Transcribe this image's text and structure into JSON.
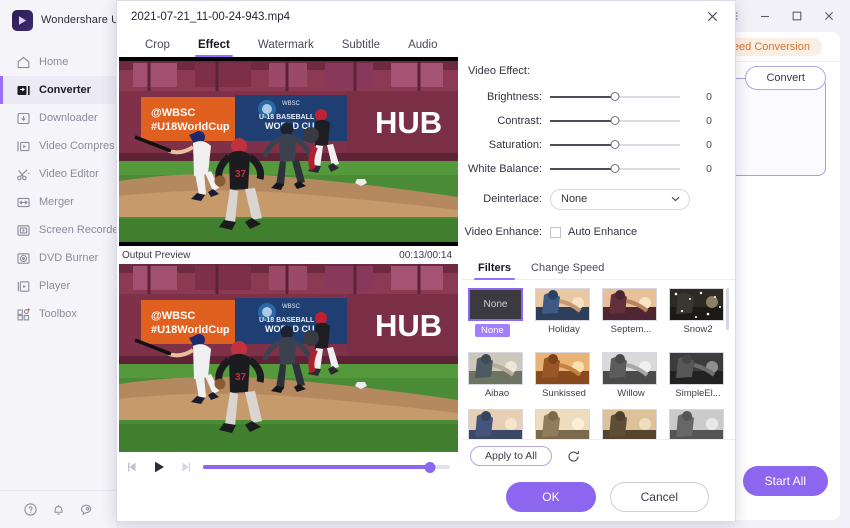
{
  "sidebar": {
    "brand": "Wondershare U",
    "items": [
      {
        "label": "Home",
        "icon": "home-icon",
        "active": false
      },
      {
        "label": "Converter",
        "icon": "converter-icon",
        "active": true
      },
      {
        "label": "Downloader",
        "icon": "download-icon",
        "active": false
      },
      {
        "label": "Video Compres",
        "icon": "compress-icon",
        "active": false
      },
      {
        "label": "Video Editor",
        "icon": "scissors-icon",
        "active": false
      },
      {
        "label": "Merger",
        "icon": "merge-icon",
        "active": false
      },
      {
        "label": "Screen Recorde",
        "icon": "record-icon",
        "active": false
      },
      {
        "label": "DVD Burner",
        "icon": "disc-icon",
        "active": false
      },
      {
        "label": "Player",
        "icon": "player-icon",
        "active": false
      },
      {
        "label": "Toolbox",
        "icon": "toolbox-icon",
        "active": false
      }
    ],
    "bottom_icons": [
      "help-icon",
      "bell-icon",
      "feedback-icon"
    ]
  },
  "background": {
    "window_controls": [
      "menu-icon",
      "minimize-icon",
      "maximize-icon",
      "close-icon"
    ],
    "speed_chip": "Speed Conversion",
    "convert_button": "Convert",
    "start_all_button": "Start All"
  },
  "dialog": {
    "title": "2021-07-21_11-00-24-943.mp4",
    "close_icon": "close-icon",
    "tabs": [
      {
        "label": "Crop",
        "active": false
      },
      {
        "label": "Effect",
        "active": true
      },
      {
        "label": "Watermark",
        "active": false
      },
      {
        "label": "Subtitle",
        "active": false
      },
      {
        "label": "Audio",
        "active": false
      }
    ],
    "preview": {
      "label": "Output Preview",
      "time": "00:13/00:14",
      "progress_percent": 92,
      "controls": [
        "step-back-icon",
        "play-icon",
        "step-forward-icon"
      ]
    },
    "video_effect": {
      "section_title": "Video Effect:",
      "sliders": [
        {
          "label": "Brightness:",
          "value": "0",
          "percent": 50
        },
        {
          "label": "Contrast:",
          "value": "0",
          "percent": 50
        },
        {
          "label": "Saturation:",
          "value": "0",
          "percent": 50
        },
        {
          "label": "White Balance:",
          "value": "0",
          "percent": 50
        }
      ],
      "deinterlace": {
        "label": "Deinterlace:",
        "value": "None",
        "options": [
          "None"
        ]
      },
      "video_enhance": {
        "label": "Video Enhance:",
        "checkbox_label": "Auto Enhance",
        "checked": false
      }
    },
    "filters": {
      "tabs": [
        {
          "label": "Filters",
          "active": true
        },
        {
          "label": "Change Speed",
          "active": false
        }
      ],
      "items": [
        {
          "name": "None",
          "selected": true,
          "style": "none"
        },
        {
          "name": "Holiday",
          "selected": false,
          "style": "holiday"
        },
        {
          "name": "Septem...",
          "selected": false,
          "style": "september"
        },
        {
          "name": "Snow2",
          "selected": false,
          "style": "snow2"
        },
        {
          "name": "Aibao",
          "selected": false,
          "style": "aibao"
        },
        {
          "name": "Sunkissed",
          "selected": false,
          "style": "sunkissed"
        },
        {
          "name": "Willow",
          "selected": false,
          "style": "willow"
        },
        {
          "name": "SimpleEl...",
          "selected": false,
          "style": "simpleel"
        },
        {
          "name": "",
          "selected": false,
          "style": "row3a"
        },
        {
          "name": "",
          "selected": false,
          "style": "row3b"
        },
        {
          "name": "",
          "selected": false,
          "style": "row3c"
        },
        {
          "name": "",
          "selected": false,
          "style": "row3d"
        }
      ],
      "apply_to_all": "Apply to All",
      "reset_icon": "reset-icon"
    },
    "footer": {
      "ok_label": "OK",
      "cancel_label": "Cancel"
    }
  },
  "colors": {
    "accent_purple": "#8d66f0",
    "accent_light": "#9b6dff",
    "sidebar_bg": "#f5f4f9",
    "chip_orange": "#d4732f",
    "chip_orange_bg": "#fdeee4"
  },
  "video_scene": {
    "banner_text_1": "@WBSC",
    "banner_text_2": "#U18WorldCup",
    "wall_text": "HUB",
    "center_logo_text": "WBSC"
  }
}
